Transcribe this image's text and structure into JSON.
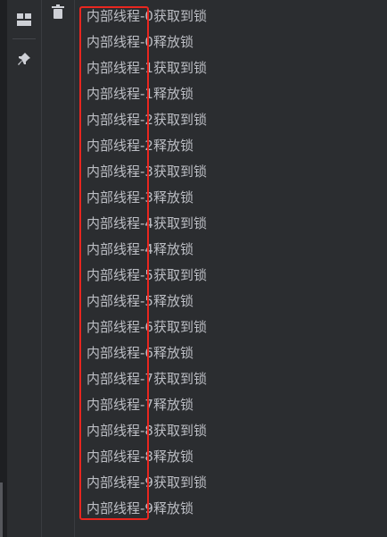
{
  "console": {
    "lines": [
      "内部线程-0获取到锁",
      "内部线程-0释放锁",
      "内部线程-1获取到锁",
      "内部线程-1释放锁",
      "内部线程-2获取到锁",
      "内部线程-2释放锁",
      "内部线程-3获取到锁",
      "内部线程-3释放锁",
      "内部线程-4获取到锁",
      "内部线程-4释放锁",
      "内部线程-5获取到锁",
      "内部线程-5释放锁",
      "内部线程-6获取到锁",
      "内部线程-6释放锁",
      "内部线程-7获取到锁",
      "内部线程-7释放锁",
      "内部线程-8获取到锁",
      "内部线程-8释放锁",
      "内部线程-9获取到锁",
      "内部线程-9释放锁"
    ]
  },
  "toolbar": {
    "icons": [
      "layout-icon",
      "pin-icon",
      "trash-icon"
    ]
  },
  "colors": {
    "background": "#2b2d30",
    "text": "#bcbec4",
    "highlight": "#e8261f"
  }
}
